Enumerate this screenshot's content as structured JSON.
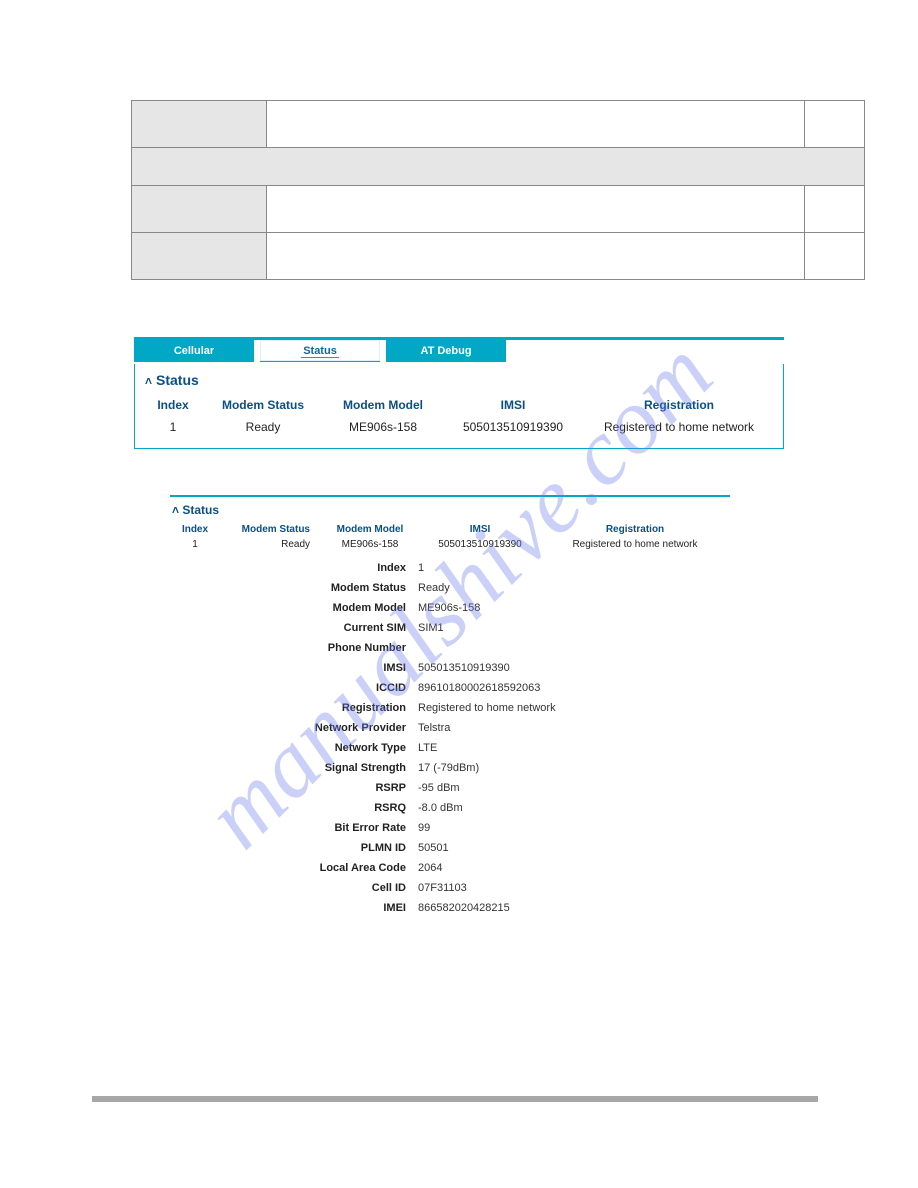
{
  "watermark": "manualshive.com",
  "tabs": {
    "cellular": "Cellular",
    "status": "Status",
    "at_debug": "AT Debug"
  },
  "panel1": {
    "title": "Status",
    "headers": [
      "Index",
      "Modem Status",
      "Modem Model",
      "IMSI",
      "Registration"
    ],
    "row": {
      "index": "1",
      "modem_status": "Ready",
      "modem_model": "ME906s-158",
      "imsi": "505013510919390",
      "registration": "Registered to home network"
    }
  },
  "panel2": {
    "title": "Status",
    "headers": [
      "Index",
      "Modem Status",
      "Modem Model",
      "IMSI",
      "Registration"
    ],
    "row": {
      "index": "1",
      "modem_status": "Ready",
      "modem_model": "ME906s-158",
      "imsi": "505013510919390",
      "registration": "Registered to home network"
    },
    "details": [
      {
        "label": "Index",
        "value": "1"
      },
      {
        "label": "Modem Status",
        "value": "Ready"
      },
      {
        "label": "Modem Model",
        "value": "ME906s-158"
      },
      {
        "label": "Current SIM",
        "value": "SIM1"
      },
      {
        "label": "Phone Number",
        "value": ""
      },
      {
        "label": "IMSI",
        "value": "505013510919390"
      },
      {
        "label": "ICCID",
        "value": "89610180002618592063"
      },
      {
        "label": "Registration",
        "value": "Registered to home network"
      },
      {
        "label": "Network Provider",
        "value": "Telstra"
      },
      {
        "label": "Network Type",
        "value": "LTE"
      },
      {
        "label": "Signal Strength",
        "value": "17 (-79dBm)"
      },
      {
        "label": "RSRP",
        "value": "-95 dBm"
      },
      {
        "label": "RSRQ",
        "value": "-8.0 dBm"
      },
      {
        "label": "Bit Error Rate",
        "value": "99"
      },
      {
        "label": "PLMN ID",
        "value": "50501"
      },
      {
        "label": "Local Area Code",
        "value": "2064"
      },
      {
        "label": "Cell ID",
        "value": "07F31103"
      },
      {
        "label": "IMEI",
        "value": "866582020428215"
      }
    ]
  }
}
